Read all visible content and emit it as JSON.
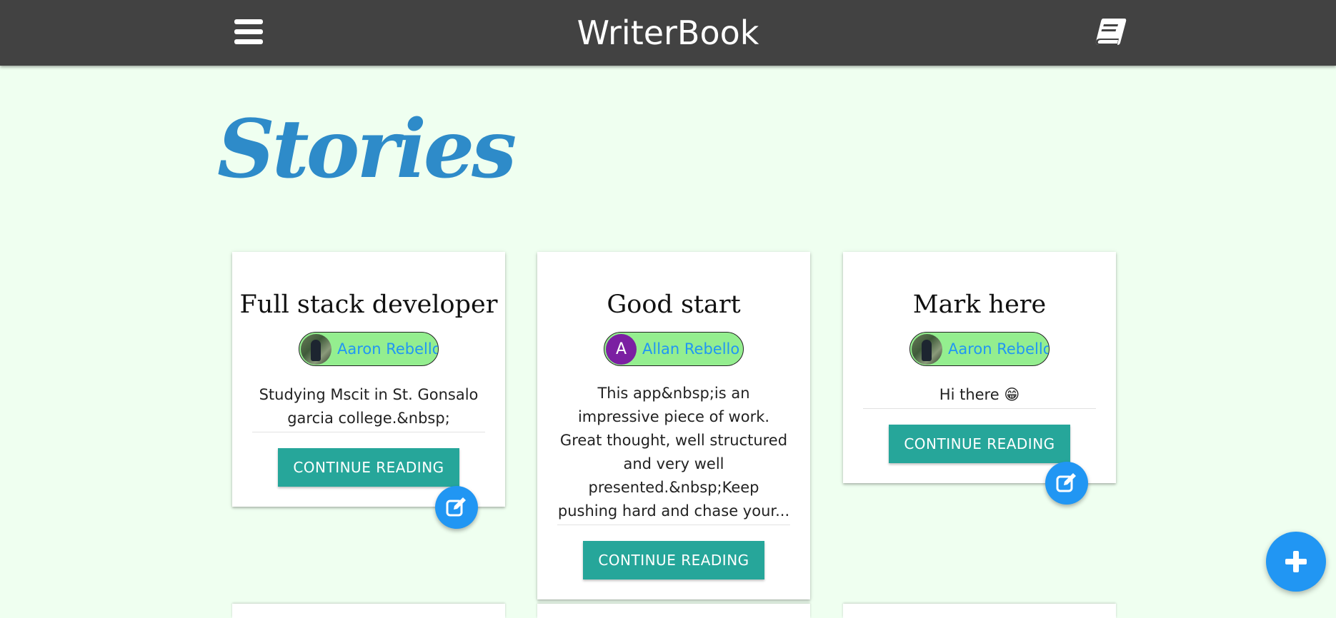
{
  "navbar": {
    "brand": "WriterBook",
    "menu_icon": "hamburger-menu-icon",
    "book_icon": "book-icon"
  },
  "page": {
    "title": "Stories"
  },
  "colors": {
    "navbar_bg": "#424242",
    "page_bg": "#effff0",
    "title": "#2e8bc9",
    "chip_bg": "#94ee8f",
    "author_link": "#2196f3",
    "button": "#26a69a",
    "fab": "#2196f3",
    "letter_avatar": "#7b1fa2"
  },
  "stories": [
    {
      "title": "Full stack developer",
      "author": "Aaron Rebello",
      "avatar_type": "photo",
      "excerpt": "Studying Mscit in St. Gonsalo garcia college.&nbsp;",
      "button_label": "Continue Reading",
      "editable": true
    },
    {
      "title": "Good start",
      "author": "Allan Rebello",
      "avatar_type": "letter",
      "avatar_letter": "A",
      "excerpt": "This app&nbsp;is an impressive piece of work. Great thought, well structured and very well presented.&nbsp;Keep pushing hard and chase your...",
      "button_label": "Continue Reading",
      "editable": false
    },
    {
      "title": "Mark here",
      "author": "Aaron Rebello",
      "avatar_type": "photo",
      "excerpt": "Hi there 😁",
      "button_label": "Continue Reading",
      "editable": true
    }
  ],
  "fab": {
    "icon": "plus-icon"
  }
}
